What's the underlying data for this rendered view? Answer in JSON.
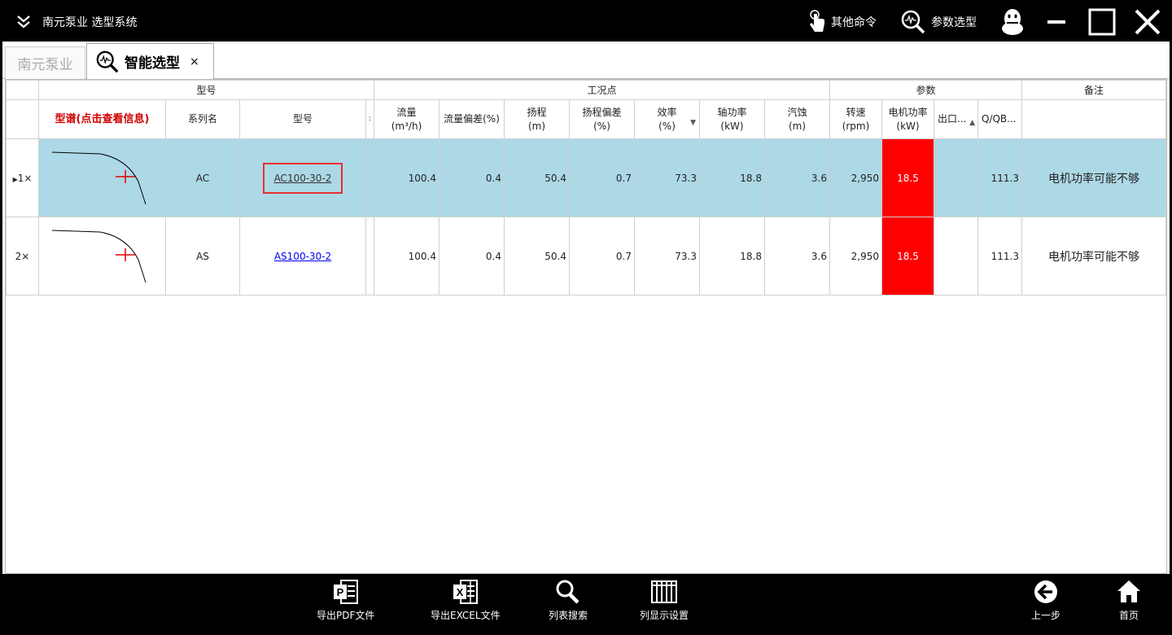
{
  "titlebar": {
    "app_title": "南元泵业 选型系统",
    "other_commands": "其他命令",
    "param_selection": "参数选型"
  },
  "tabs": {
    "home": "南元泵业",
    "active": "智能选型",
    "close": "×"
  },
  "table": {
    "groups": [
      "型号",
      "工况点",
      "参数",
      "备注"
    ],
    "columns": {
      "spectrum": "型谱(点击查看信息)",
      "series": "系列名",
      "model": "型号",
      "flow": [
        "流量",
        "(m³/h)"
      ],
      "flow_dev": "流量偏差(%)",
      "head": [
        "扬程",
        "(m)"
      ],
      "head_dev": [
        "扬程偏差",
        "(%)"
      ],
      "eff": [
        "效率",
        "(%)"
      ],
      "shaft_power": [
        "轴功率",
        "(kW)"
      ],
      "npsh": [
        "汽蚀",
        "(m)"
      ],
      "speed": [
        "转速",
        "(rpm)"
      ],
      "motor_power": [
        "电机功率",
        "(kW)"
      ],
      "outlet": "出口...",
      "qqb": "Q/QB..."
    },
    "rows": [
      {
        "index": "1×",
        "series": "AC",
        "model": "AC100-30-2",
        "flow": "100.4",
        "flow_dev": "0.4",
        "head": "50.4",
        "head_dev": "0.7",
        "eff": "73.3",
        "shaft_power": "18.8",
        "npsh": "3.6",
        "speed": "2,950",
        "motor_power": "18.5",
        "outlet": "",
        "qqb": "111.3",
        "note": "电机功率可能不够"
      },
      {
        "index": "2×",
        "series": "AS",
        "model": "AS100-30-2",
        "flow": "100.4",
        "flow_dev": "0.4",
        "head": "50.4",
        "head_dev": "0.7",
        "eff": "73.3",
        "shaft_power": "18.8",
        "npsh": "3.6",
        "speed": "2,950",
        "motor_power": "18.5",
        "outlet": "",
        "qqb": "111.3",
        "note": "电机功率可能不够"
      }
    ]
  },
  "bottombar": {
    "export_pdf": "导出PDF文件",
    "export_excel": "导出EXCEL文件",
    "list_search": "列表搜索",
    "column_settings": "列显示设置",
    "back": "上一步",
    "home": "首页"
  },
  "colors": {
    "selected_row": "#add8e6",
    "motor_power_alert": "#ff0000",
    "spectrum_header": "#d00000",
    "model_highlight_box": "#e53030"
  }
}
